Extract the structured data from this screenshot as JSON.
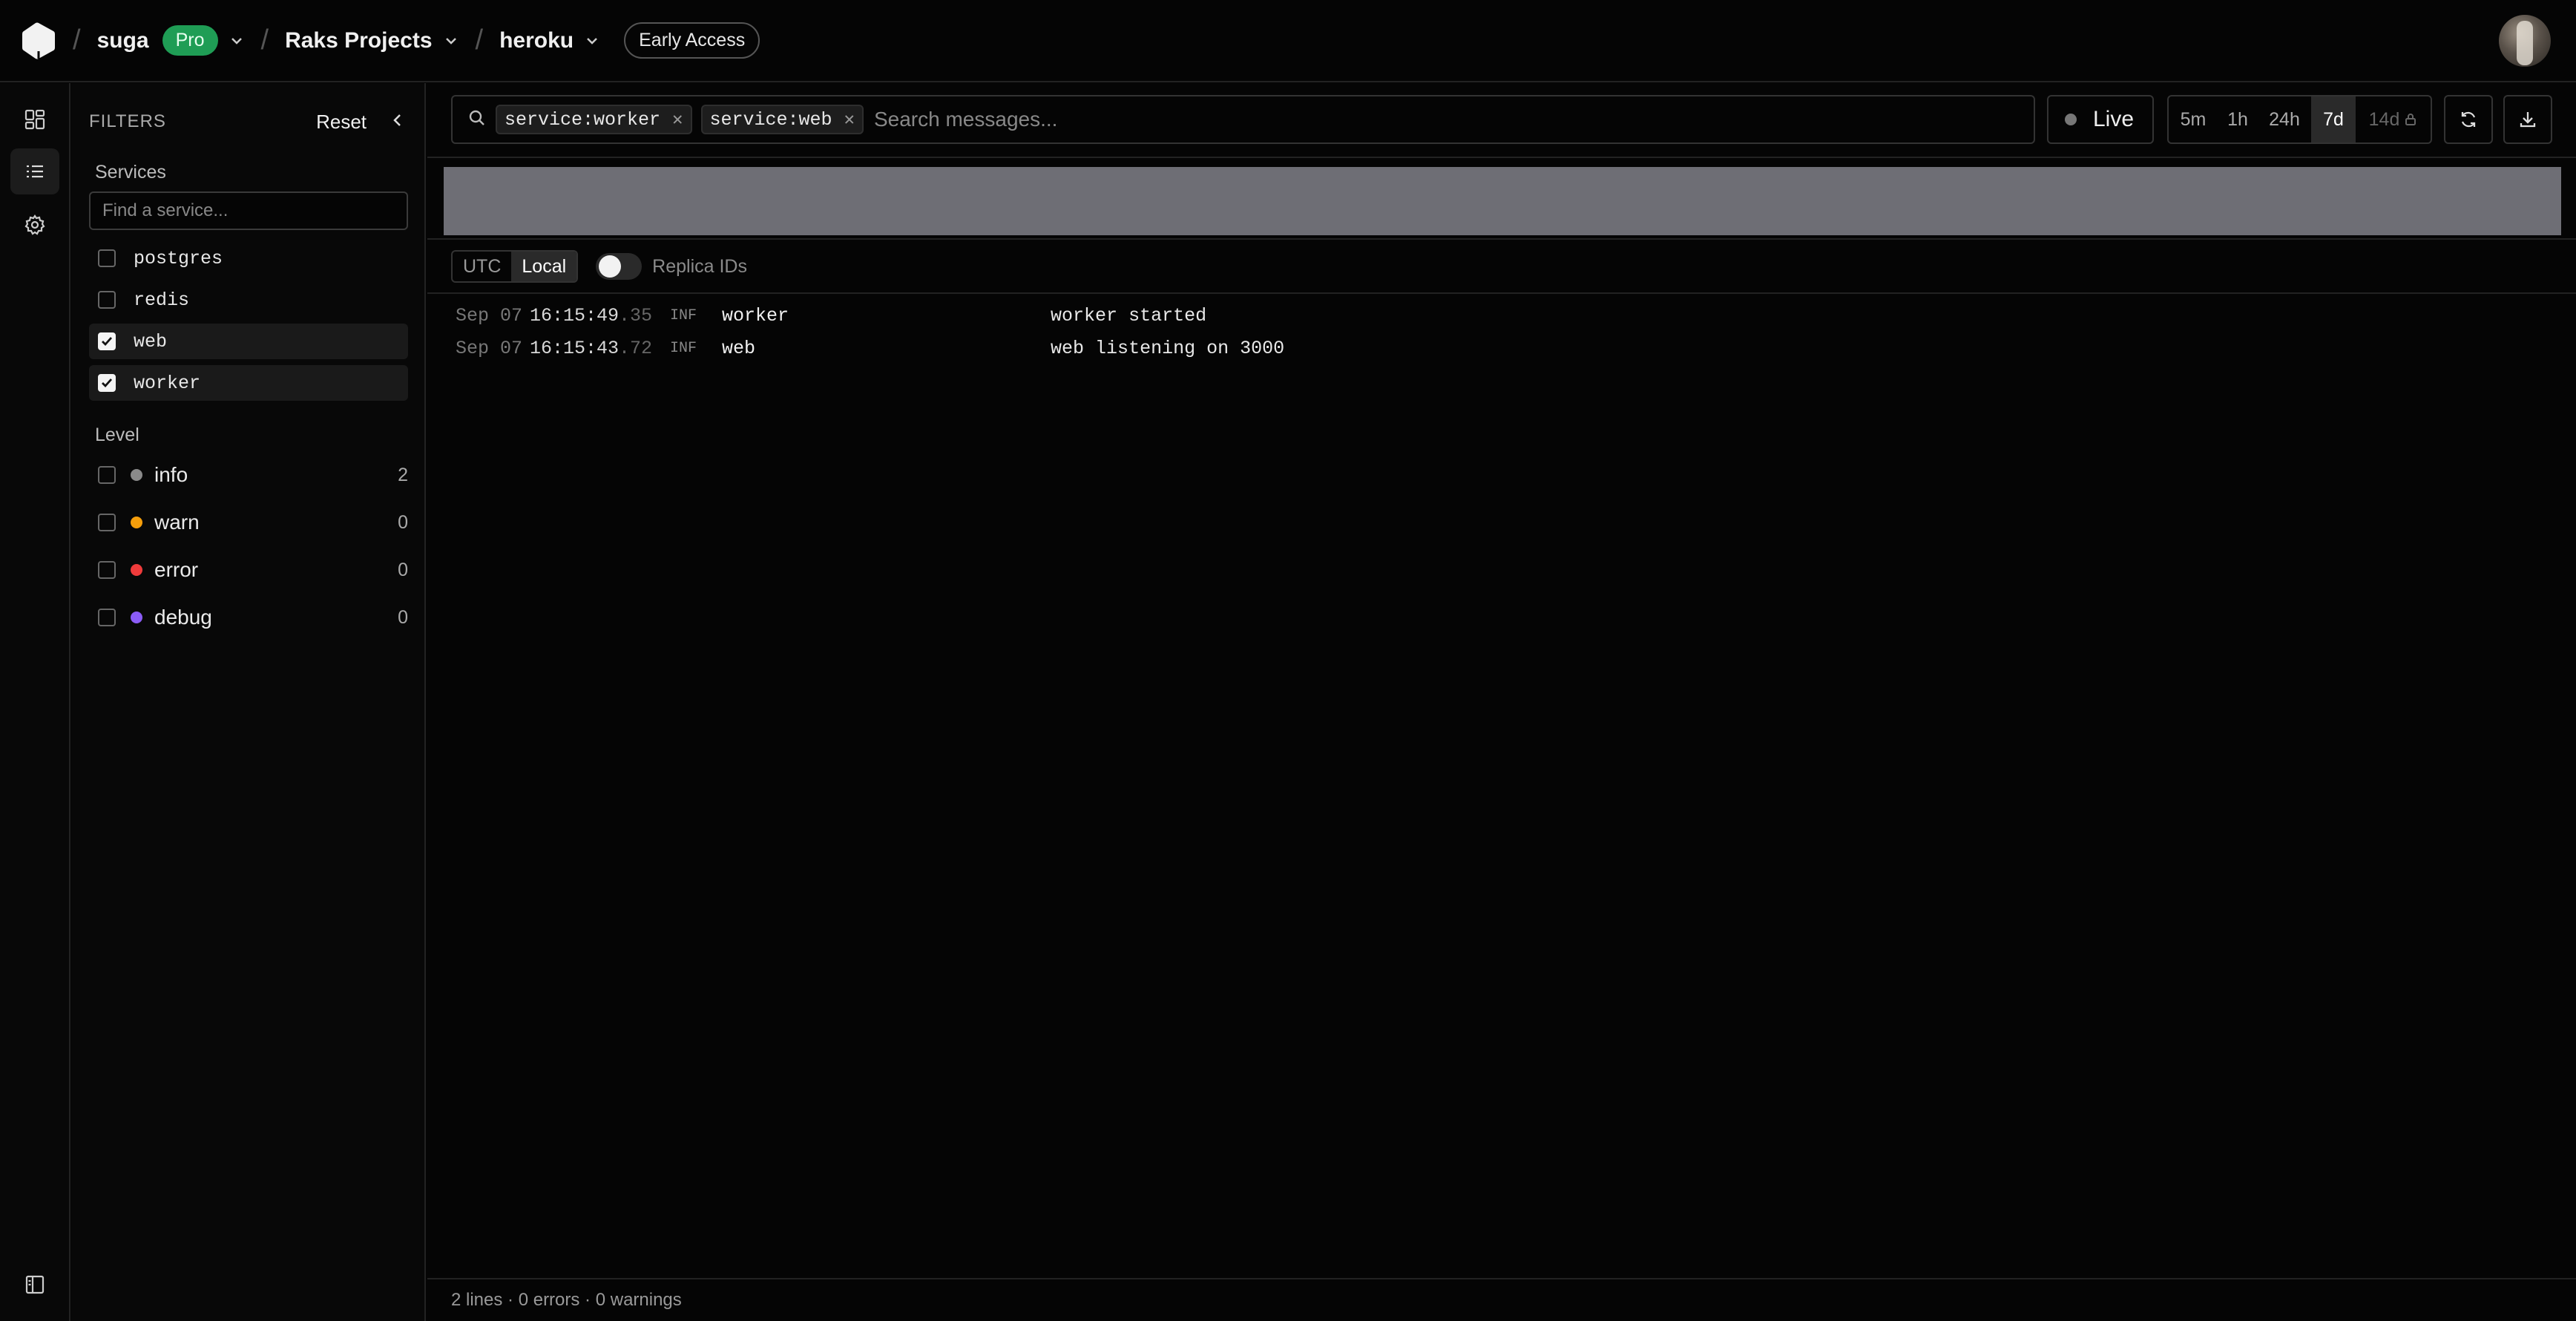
{
  "header": {
    "workspace": "suga",
    "plan_badge": "Pro",
    "project": "Raks Projects",
    "app": "heroku",
    "early_access": "Early Access"
  },
  "filters": {
    "title": "FILTERS",
    "reset_label": "Reset",
    "services_label": "Services",
    "service_search_placeholder": "Find a service...",
    "services": [
      {
        "name": "postgres",
        "checked": false
      },
      {
        "name": "redis",
        "checked": false
      },
      {
        "name": "web",
        "checked": true
      },
      {
        "name": "worker",
        "checked": true
      }
    ],
    "level_label": "Level",
    "levels": [
      {
        "name": "info",
        "count": "2",
        "color": "#8a8a8a"
      },
      {
        "name": "warn",
        "count": "0",
        "color": "#f59e0b"
      },
      {
        "name": "error",
        "count": "0",
        "color": "#ef3b3b"
      },
      {
        "name": "debug",
        "count": "0",
        "color": "#8b5cf6"
      }
    ]
  },
  "search": {
    "chips": [
      "service:worker",
      "service:web"
    ],
    "placeholder": "Search messages..."
  },
  "live_label": "Live",
  "time_ranges": [
    {
      "label": "5m",
      "active": false
    },
    {
      "label": "1h",
      "active": false
    },
    {
      "label": "24h",
      "active": false
    },
    {
      "label": "7d",
      "active": true
    },
    {
      "label": "14d",
      "active": false,
      "locked": true
    }
  ],
  "timezone": {
    "options": [
      "UTC",
      "Local"
    ],
    "selected": "Local"
  },
  "replica_label": "Replica IDs",
  "logs": [
    {
      "date": "Sep 07",
      "time": "16:15:49",
      "ms": ".35",
      "level": "INF",
      "service": "worker",
      "message": "worker started"
    },
    {
      "date": "Sep 07",
      "time": "16:15:43",
      "ms": ".72",
      "level": "INF",
      "service": "web",
      "message": "web listening on 3000"
    }
  ],
  "footer_status": "2 lines · 0 errors · 0 warnings"
}
